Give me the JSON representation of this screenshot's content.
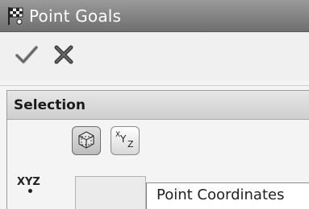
{
  "window": {
    "title": "Point Goals",
    "title_icon": "checkered-flag-icon"
  },
  "toolbar": {
    "ok_icon": "check-icon",
    "cancel_icon": "close-x-icon"
  },
  "selection": {
    "header": "Selection",
    "select_by_geometry_icon": "cube-select-icon",
    "coordinates_icon": "xyz-coordinates-icon",
    "coordinates_icon_text": {
      "x": "X",
      "y": "Y",
      "z": "Z"
    },
    "field_label": "XYZ",
    "field_value": "",
    "tooltip": "Point Coordinates"
  }
}
